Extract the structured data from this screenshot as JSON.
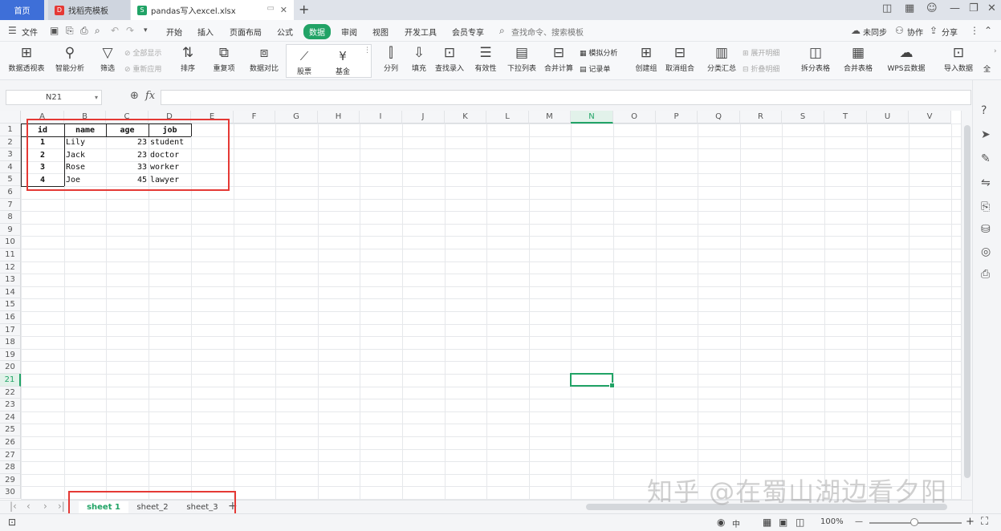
{
  "tabs": {
    "home": "首页",
    "template": "找稻壳模板",
    "file": "pandas写入excel.xlsx",
    "new_tab": "+"
  },
  "menu": {
    "file": "文件",
    "items": [
      "开始",
      "插入",
      "页面布局",
      "公式",
      "数据",
      "审阅",
      "视图",
      "开发工具",
      "会员专享"
    ],
    "active": "数据",
    "search_placeholder": "查找命令、搜索模板",
    "sync": "未同步",
    "collab": "协作",
    "share": "分享"
  },
  "ribbon": {
    "pivot": "数据透视表",
    "smart": "智能分析",
    "filter": "筛选",
    "show_all": "全部显示",
    "reapply": "重新应用",
    "sort": "排序",
    "dup": "重复项",
    "compare": "数据对比",
    "stock": "股票",
    "fund": "基金",
    "split": "分列",
    "fill": "填充",
    "lookup": "查找录入",
    "valid": "有效性",
    "dropdown": "下拉列表",
    "merge_calc": "合并计算",
    "simulate": "模拟分析",
    "record": "记录单",
    "create_group": "创建组",
    "ungroup": "取消组合",
    "subtotal": "分类汇总",
    "expand": "展开明细",
    "collapse": "折叠明细",
    "split_table": "拆分表格",
    "merge_table": "合并表格",
    "wps_cloud": "WPS云数据",
    "import": "导入数据",
    "more": "全"
  },
  "formula_bar": {
    "name_box": "N21",
    "fx": "fx",
    "value": ""
  },
  "columns": [
    "A",
    "B",
    "C",
    "D",
    "E",
    "F",
    "G",
    "H",
    "I",
    "J",
    "K",
    "L",
    "M",
    "N",
    "O",
    "P",
    "Q",
    "R",
    "S",
    "T",
    "U",
    "V"
  ],
  "rows": [
    "1",
    "2",
    "3",
    "4",
    "5",
    "6",
    "7",
    "8",
    "9",
    "10",
    "11",
    "12",
    "13",
    "14",
    "15",
    "16",
    "17",
    "18",
    "19",
    "20",
    "21",
    "22",
    "23",
    "24",
    "25",
    "26",
    "27",
    "28",
    "29",
    "30"
  ],
  "selected_cell": {
    "col": "N",
    "row": "21"
  },
  "table": {
    "headers": [
      "id",
      "name",
      "age",
      "job"
    ],
    "rows": [
      [
        "1",
        "Lily",
        "23",
        "student"
      ],
      [
        "2",
        "Jack",
        "23",
        "doctor"
      ],
      [
        "3",
        "Rose",
        "33",
        "worker"
      ],
      [
        "4",
        "Joe",
        "45",
        "lawyer"
      ]
    ]
  },
  "sheets": [
    "sheet 1",
    "sheet_2",
    "sheet_3"
  ],
  "active_sheet": "sheet 1",
  "status": {
    "zoom": "100%",
    "view_mode": "中"
  },
  "watermark": "知乎 @在蜀山湖边看夕阳",
  "colors": {
    "accent": "#21a366",
    "highlight": "#e53935",
    "home_tab": "#3e6fd8"
  }
}
